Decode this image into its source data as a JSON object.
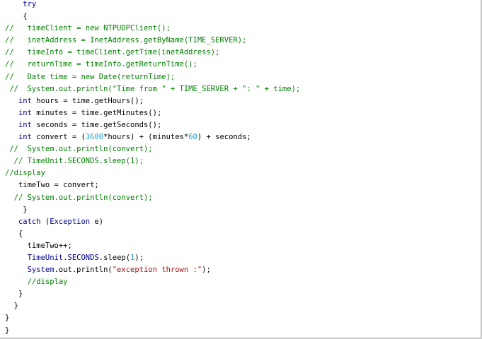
{
  "editor": {
    "lines": [
      [
        {
          "t": "    ",
          "k": "pl"
        },
        {
          "t": "try",
          "k": "kw"
        }
      ],
      [
        {
          "t": "    {",
          "k": "pl"
        }
      ],
      [
        {
          "t": "//   timeClient = new NTPUDPClient();",
          "k": "com"
        }
      ],
      [
        {
          "t": "//   inetAddress = InetAddress.getByName(TIME_SERVER);",
          "k": "com"
        }
      ],
      [
        {
          "t": "//   timeInfo = timeClient.getTime(inetAddress);",
          "k": "com"
        }
      ],
      [
        {
          "t": "//   returnTime = timeInfo.getReturnTime();",
          "k": "com"
        }
      ],
      [
        {
          "t": "//   Date time = new Date(returnTime);",
          "k": "com"
        }
      ],
      [
        {
          "t": " //  System.out.println(\"Time from \" + TIME_SERVER + \": \" + time);",
          "k": "com"
        }
      ],
      [
        {
          "t": "   ",
          "k": "pl"
        },
        {
          "t": "int",
          "k": "kw"
        },
        {
          "t": " hours = time.getHours();",
          "k": "pl"
        }
      ],
      [
        {
          "t": "   ",
          "k": "pl"
        },
        {
          "t": "int",
          "k": "kw"
        },
        {
          "t": " minutes = time.getMinutes();",
          "k": "pl"
        }
      ],
      [
        {
          "t": "   ",
          "k": "pl"
        },
        {
          "t": "int",
          "k": "kw"
        },
        {
          "t": " seconds = time.getSeconds();",
          "k": "pl"
        }
      ],
      [
        {
          "t": "   ",
          "k": "pl"
        },
        {
          "t": "int",
          "k": "kw"
        },
        {
          "t": " convert = (",
          "k": "pl"
        },
        {
          "t": "3600",
          "k": "num"
        },
        {
          "t": "*hours) + (minutes*",
          "k": "pl"
        },
        {
          "t": "60",
          "k": "num"
        },
        {
          "t": ") + seconds;",
          "k": "pl"
        }
      ],
      [
        {
          "t": " //  System.out.println(convert);",
          "k": "com"
        }
      ],
      [
        {
          "t": "  // TimeUnit.SECONDS.sleep(1);",
          "k": "com"
        }
      ],
      [
        {
          "t": "//display",
          "k": "com"
        }
      ],
      [
        {
          "t": "   timeTwo = convert;",
          "k": "pl"
        }
      ],
      [
        {
          "t": "  // System.out.println(convert);",
          "k": "com"
        }
      ],
      [
        {
          "t": "    }",
          "k": "pl"
        }
      ],
      [
        {
          "t": "   ",
          "k": "pl"
        },
        {
          "t": "catch",
          "k": "kw"
        },
        {
          "t": " (",
          "k": "pl"
        },
        {
          "t": "Exception",
          "k": "kw"
        },
        {
          "t": " e)",
          "k": "pl"
        }
      ],
      [
        {
          "t": "   {",
          "k": "pl"
        }
      ],
      [
        {
          "t": "     timeTwo++;",
          "k": "pl"
        }
      ],
      [
        {
          "t": "     ",
          "k": "pl"
        },
        {
          "t": "TimeUnit",
          "k": "kw"
        },
        {
          "t": ".",
          "k": "pl"
        },
        {
          "t": "SECONDS",
          "k": "kw"
        },
        {
          "t": ".sleep(",
          "k": "pl"
        },
        {
          "t": "1",
          "k": "num"
        },
        {
          "t": ");",
          "k": "pl"
        }
      ],
      [
        {
          "t": "     ",
          "k": "pl"
        },
        {
          "t": "System",
          "k": "kw"
        },
        {
          "t": ".out.println(",
          "k": "pl"
        },
        {
          "t": "\"exception thrown :\"",
          "k": "str"
        },
        {
          "t": ");",
          "k": "pl"
        }
      ],
      [
        {
          "t": "     //display",
          "k": "com"
        }
      ],
      [
        {
          "t": "   }",
          "k": "pl"
        }
      ],
      [
        {
          "t": "  }",
          "k": "pl"
        }
      ],
      [
        {
          "t": "}",
          "k": "pl"
        }
      ],
      [
        {
          "t": "}",
          "k": "pl"
        }
      ]
    ]
  },
  "colors": {
    "keyword": "#00008b",
    "comment": "#008000",
    "number": "#2a9fd6",
    "string": "#a31515",
    "plain": "#000000",
    "background": "#ffffff"
  }
}
